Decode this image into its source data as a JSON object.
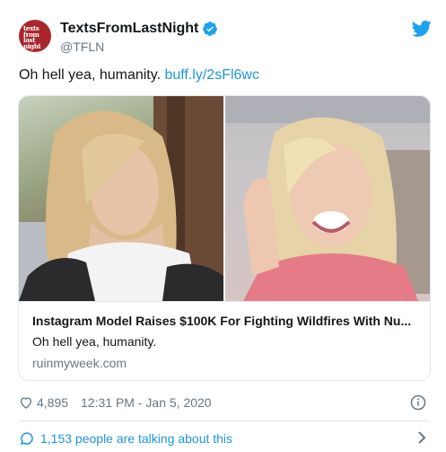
{
  "account": {
    "avatar_text": "texts\nfrom\nlast\nnight",
    "display_name": "TextsFromLastNight",
    "handle": "@TFLN",
    "verified": true
  },
  "tweet": {
    "text": "Oh hell yea, humanity. ",
    "link_text": "buff.ly/2sFl6wc"
  },
  "card": {
    "title": "Instagram Model Raises $100K For Fighting Wildfires With Nu...",
    "description": "Oh hell yea, humanity.",
    "domain": "ruinmyweek.com"
  },
  "meta": {
    "likes": "4,895",
    "timestamp": "12:31 PM - Jan 5, 2020"
  },
  "conversation": {
    "label": "1,153 people are talking about this"
  },
  "colors": {
    "link": "#1b95e0",
    "muted": "#657786",
    "text": "#14171a",
    "avatar_bg": "#a8262c"
  },
  "icons": [
    "verified-badge-icon",
    "twitter-bird-icon",
    "heart-icon",
    "info-icon",
    "speech-bubble-icon",
    "chevron-right-icon"
  ]
}
